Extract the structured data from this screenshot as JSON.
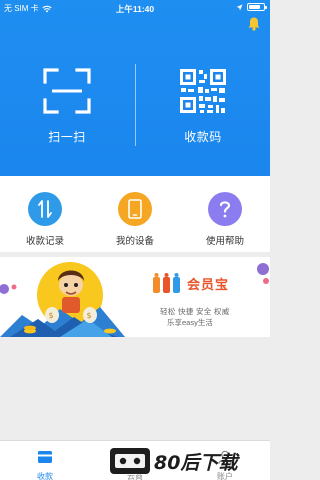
{
  "status_bar": {
    "carrier": "无 SIM 卡",
    "time": "上午11:40",
    "battery_level": 0.8
  },
  "header": {
    "scan_label": "扫一扫",
    "qr_label": "收款码"
  },
  "functions": [
    {
      "label": "收款记录",
      "icon": "transfer-icon",
      "color": "#2f9be8"
    },
    {
      "label": "我的设备",
      "icon": "tablet-icon",
      "color": "#f5a623"
    },
    {
      "label": "使用帮助",
      "icon": "question-icon",
      "color": "#8b7cf0"
    }
  ],
  "banner": {
    "brand_name": "会员宝",
    "slogan_line1": "轻松 快捷 安全 权威",
    "slogan_line2": "乐享easy生活"
  },
  "tabbar": {
    "tabs": [
      {
        "label": "收款",
        "active": true
      },
      {
        "label": "云商",
        "active": false
      },
      {
        "label": "账户",
        "active": false
      }
    ]
  },
  "watermark": {
    "text": "80后下载"
  },
  "colors": {
    "primary": "#1a86ee",
    "tab_active": "#1a86ee",
    "tab_inactive": "#888888"
  }
}
